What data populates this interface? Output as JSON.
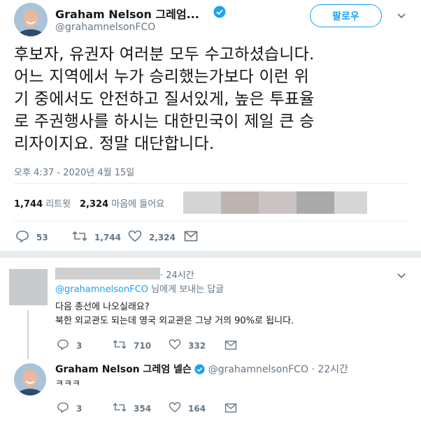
{
  "main": {
    "author_name": "Graham Nelson 그레엄...",
    "handle": "@grahamnelsonFCO",
    "follow_label": "팔로우",
    "text_lines": [
      "후보자, 유권자 여러분 모두 수고하셨습니다.",
      "어느 지역에서 누가 승리했는가보다 이런 위",
      "기 중에서도 안전하고 질서있게, 높은 투표율",
      "로 주권행사를 하시는 대한민국이 제일 큰 승",
      "리자이지요. 정말 대단합니다."
    ],
    "timestamp": "오후 4:37 - 2020년 4월 15일",
    "retweets_count": "1,744",
    "retweets_label": "리트윗",
    "likes_count": "2,324",
    "likes_label": "마음에 들어요",
    "actions": {
      "replies": "53",
      "retweets": "1,744",
      "likes": "2,324"
    }
  },
  "reply1": {
    "time": "· 24시간",
    "to_handle": "@grahamnelsonFCO",
    "to_suffix": " 님에게 보내는 답글",
    "line1": "다음 총선에 나오실래요?",
    "line2": "북한 외교관도 되는데 영국 외교관은 그냥 거의 90%로 됩니다.",
    "actions": {
      "replies": "3",
      "retweets": "710",
      "likes": "332"
    }
  },
  "reply2": {
    "author_name": "Graham Nelson 그레엄 넬슨",
    "handle": "@grahamnelsonFCO",
    "time": "· 22시간",
    "text": "ㅋㅋㅋ",
    "actions": {
      "replies": "3",
      "retweets": "354",
      "likes": "164"
    }
  },
  "colors": {
    "accent": "#1da1f2",
    "verified": "#1da1f2",
    "muted": "#657786"
  }
}
